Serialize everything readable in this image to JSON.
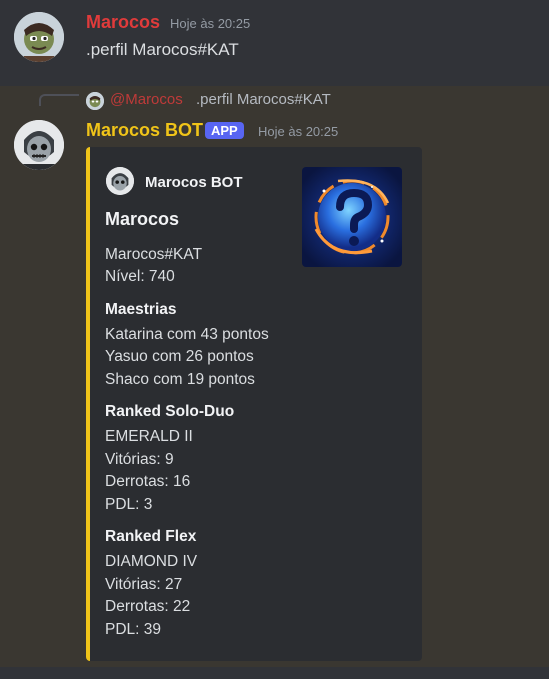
{
  "messages": [
    {
      "author": "Marocos",
      "timestamp": "Hoje às 20:25",
      "content": ".perfil Marocos#KAT"
    },
    {
      "reply": {
        "author": "@Marocos",
        "text": ".perfil Marocos#KAT"
      },
      "author": "Marocos BOT",
      "badge": "APP",
      "timestamp": "Hoje às 20:25",
      "embed": {
        "author": "Marocos BOT",
        "title": "Marocos",
        "description": [
          "Marocos#KAT",
          "Nível: 740"
        ],
        "fields": [
          {
            "name": "Maestrias",
            "lines": [
              "Katarina com 43 pontos",
              "Yasuo com 26 pontos",
              "Shaco com 19 pontos"
            ]
          },
          {
            "name": "Ranked Solo-Duo",
            "lines": [
              "EMERALD II",
              "Vitórias: 9",
              "Derrotas: 16",
              "PDL: 3"
            ]
          },
          {
            "name": "Ranked Flex",
            "lines": [
              "DIAMOND IV",
              "Vitórias: 27",
              "Derrotas: 22",
              "PDL: 39"
            ]
          }
        ]
      }
    }
  ],
  "colors": {
    "background": "#313338",
    "highlight": "#3a3731",
    "user_name": "#e03b3b",
    "bot_name": "#f0c419",
    "embed_accent": "#f0c419",
    "app_badge": "#5865f2",
    "embed_bg": "#2b2d31"
  },
  "icons": {
    "user_avatar": "cartoon-avatar-icon",
    "bot_avatar": "skull-avatar-icon",
    "thumbnail": "question-mark-orb-icon"
  }
}
